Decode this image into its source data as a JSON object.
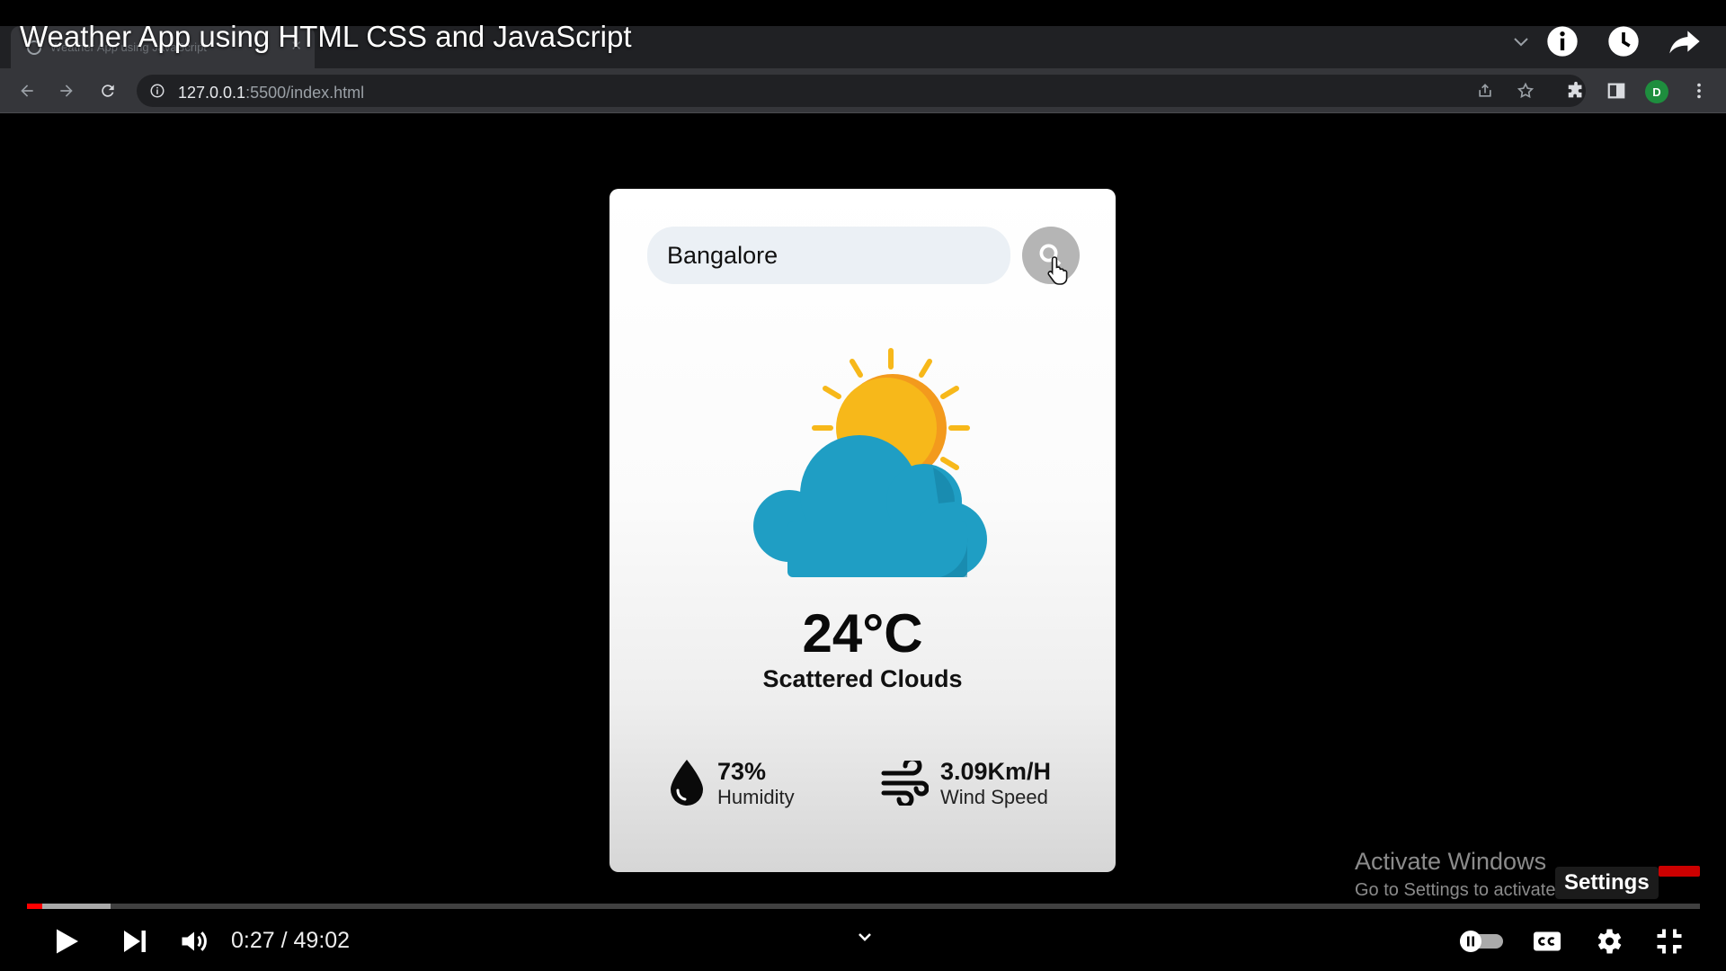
{
  "video": {
    "title": "Weather App using HTML CSS and JavaScript",
    "icons": [
      "chevron-down-icon",
      "info-icon",
      "clock-icon",
      "share-icon"
    ]
  },
  "browser": {
    "tab_title": "Weather App using JavaScript",
    "url_host": "127.0.0.1",
    "url_rest": ":5500/index.html",
    "profile_initial": "D"
  },
  "weather": {
    "city": "Bangalore",
    "temperature": "24°C",
    "condition": "Scattered Clouds",
    "humidity_value": "73%",
    "humidity_label": "Humidity",
    "wind_value": "3.09Km/H",
    "wind_label": "Wind Speed",
    "colors": {
      "sun": "#f7b81a",
      "sun_shade": "#f39a1d",
      "cloud": "#1f9ec4",
      "cloud_dark": "#137fa0"
    }
  },
  "watermark": {
    "line1": "Activate Windows",
    "line2": "Go to Settings to activate Windows."
  },
  "player": {
    "current_time": "0:27",
    "separator": " / ",
    "duration": "49:02",
    "settings_tooltip": "Settings",
    "progress_played": 0.009,
    "progress_buffered": 0.05,
    "accent": "#ff0000"
  }
}
